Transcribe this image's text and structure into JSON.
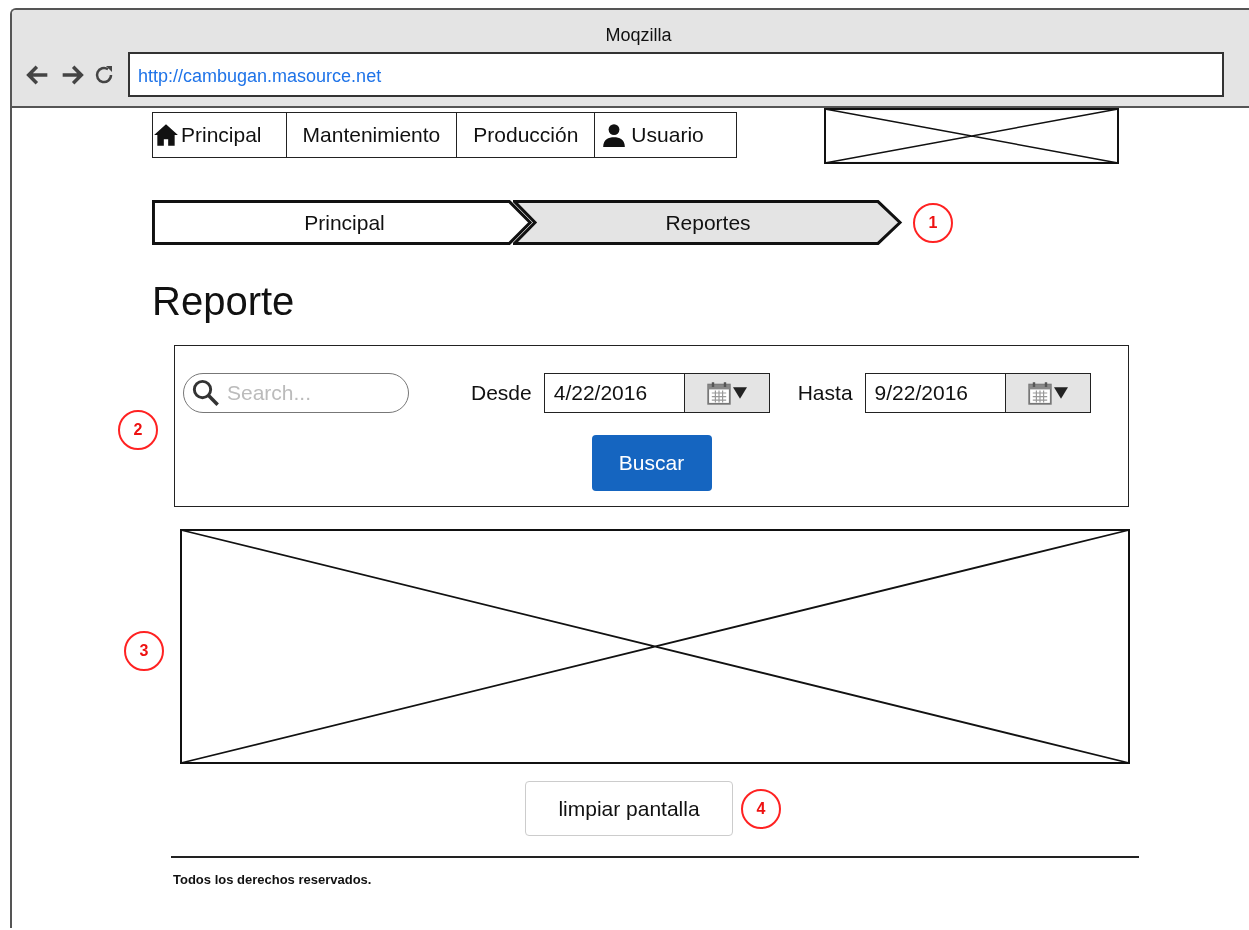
{
  "window": {
    "title": "Moqzilla",
    "url": "http://cambugan.masource.net"
  },
  "nav": [
    {
      "label": "Principal",
      "kind": "home"
    },
    {
      "label": "Mantenimiento",
      "kind": "plain"
    },
    {
      "label": "Producción",
      "kind": "plain"
    },
    {
      "label": "Usuario",
      "kind": "user"
    }
  ],
  "breadcrumb": {
    "items": [
      {
        "label": "Principal",
        "selected": false
      },
      {
        "label": "Reportes",
        "selected": true
      }
    ],
    "callout": "1"
  },
  "heading": "Reporte",
  "filter_panel": {
    "callout": "2",
    "search": {
      "placeholder": "Search..."
    },
    "dates": [
      {
        "label": "Desde",
        "value": "4/22/2016"
      },
      {
        "label": "Hasta",
        "value": "9/22/2016"
      }
    ],
    "button": "Buscar"
  },
  "report_image": {
    "kind": "picture",
    "callout": "3"
  },
  "clear_button": {
    "label": "limpiar pantalla",
    "callout": "4"
  },
  "footer": "Todos los derechos reservados."
}
